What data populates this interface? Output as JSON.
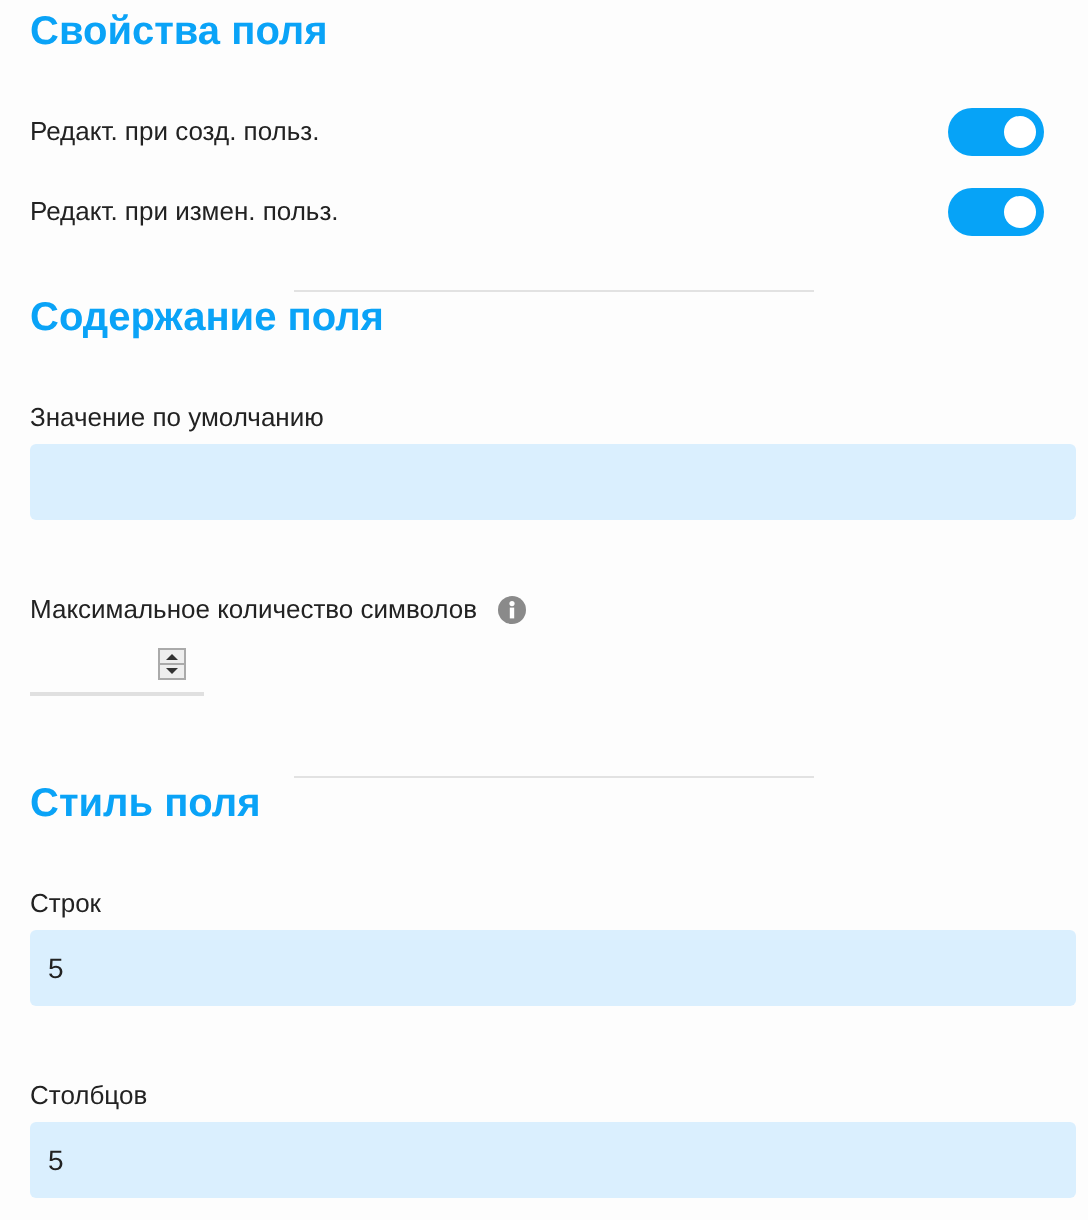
{
  "sections": [
    {
      "title": "Свойства поля",
      "items": [
        {
          "kind": "toggle",
          "label": "Редакт. при созд. польз.",
          "on": true
        },
        {
          "kind": "toggle",
          "label": "Редакт. при измен. польз.",
          "on": true
        }
      ]
    },
    {
      "title": "Содержание поля",
      "items": [
        {
          "kind": "text",
          "label": "Значение по умолчанию"
        },
        {
          "kind": "number",
          "label": "Максимальное количество символов",
          "info": true
        }
      ]
    },
    {
      "title": "Стиль поля",
      "items": [
        {
          "kind": "text",
          "label": "Строк",
          "value": "5"
        },
        {
          "kind": "text",
          "label": "Столбцов",
          "value": "5"
        }
      ]
    }
  ]
}
